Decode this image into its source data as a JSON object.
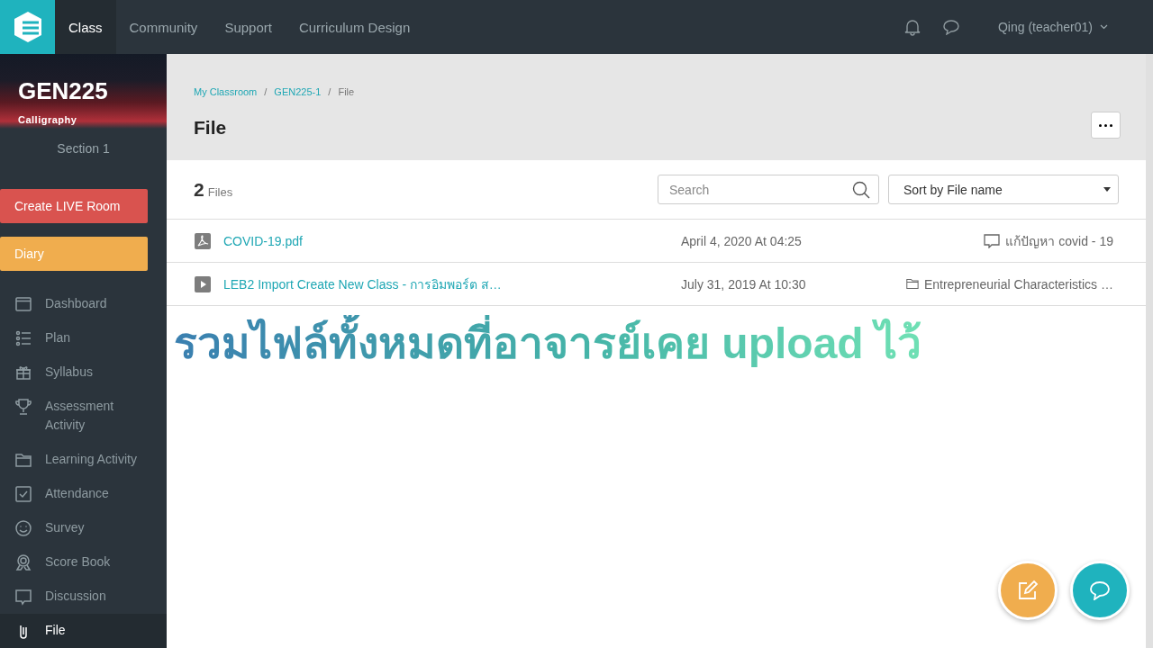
{
  "topbar": {
    "nav": [
      {
        "label": "Class",
        "selected": true
      },
      {
        "label": "Community",
        "selected": false
      },
      {
        "label": "Support",
        "selected": false
      },
      {
        "label": "Curriculum Design",
        "selected": false
      }
    ],
    "user": "Qing (teacher01)"
  },
  "sidebar": {
    "course_code": "GEN225",
    "course_name": "Calligraphy",
    "section": "Section 1",
    "buttons": [
      {
        "label": "Create LIVE Room",
        "kind": "live"
      },
      {
        "label": "Diary",
        "kind": "diary"
      }
    ],
    "menu": [
      {
        "label": "Dashboard",
        "selected": false
      },
      {
        "label": "Plan",
        "selected": false
      },
      {
        "label": "Syllabus",
        "selected": false
      },
      {
        "label": "Assessment Activity",
        "selected": false
      },
      {
        "label": "Learning Activity",
        "selected": false
      },
      {
        "label": "Attendance",
        "selected": false
      },
      {
        "label": "Survey",
        "selected": false
      },
      {
        "label": "Score Book",
        "selected": false
      },
      {
        "label": "Discussion",
        "selected": false
      },
      {
        "label": "File",
        "selected": true
      }
    ]
  },
  "breadcrumb": {
    "separator": "/",
    "items": [
      "My Classroom",
      "GEN225-1",
      "File"
    ]
  },
  "title": "File",
  "count": "2",
  "count_label": "Files",
  "search": {
    "placeholder": "Search"
  },
  "sort": {
    "value": "Sort by File name"
  },
  "files": [
    {
      "kind": "pdf",
      "name": "COVID-19.pdf",
      "date": "April 4, 2020 At 04:25",
      "location": {
        "kind": "discussion",
        "text": "แก้ปัญหา covid - 19"
      }
    },
    {
      "kind": "video",
      "name": "LEB2 Import Create New Class - การอิมพอร์ต ส…",
      "date": "July 31, 2019 At 10:30",
      "location": {
        "kind": "folder",
        "text": "Entrepreneurial Characteristics …"
      }
    }
  ],
  "caption": "รวมไฟล์ทั้งหมดที่อาจารย์เคย upload ไว้"
}
